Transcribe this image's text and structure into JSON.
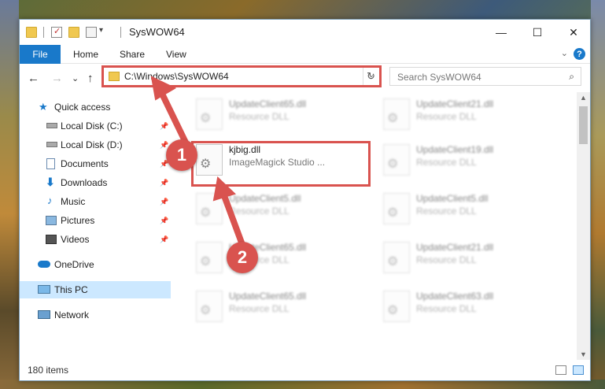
{
  "window": {
    "title": "SysWOW64",
    "minimize": "—",
    "maximize": "☐",
    "close": "✕"
  },
  "ribbon": {
    "file": "File",
    "home": "Home",
    "share": "Share",
    "view": "View",
    "help": "?"
  },
  "address": {
    "path": "C:\\Windows\\SysWOW64",
    "refresh": "↻"
  },
  "search": {
    "placeholder": "Search SysWOW64",
    "icon": "⌕"
  },
  "nav": {
    "back": "←",
    "forward": "→",
    "recent": "⌄",
    "up": "↑"
  },
  "sidebar": {
    "items": [
      {
        "label": "Quick access",
        "icon": "star-icon"
      },
      {
        "label": "Local Disk (C:)",
        "icon": "drive-icon",
        "pinned": true
      },
      {
        "label": "Local Disk (D:)",
        "icon": "drive-icon",
        "pinned": true
      },
      {
        "label": "Documents",
        "icon": "documents-icon",
        "pinned": true
      },
      {
        "label": "Downloads",
        "icon": "download-icon",
        "pinned": true
      },
      {
        "label": "Music",
        "icon": "music-icon",
        "pinned": true
      },
      {
        "label": "Pictures",
        "icon": "pictures-icon",
        "pinned": true
      },
      {
        "label": "Videos",
        "icon": "videos-icon",
        "pinned": true
      },
      {
        "label": "OneDrive",
        "icon": "cloud-icon"
      },
      {
        "label": "This PC",
        "icon": "computer-icon",
        "selected": true
      },
      {
        "label": "Network",
        "icon": "network-icon"
      }
    ]
  },
  "files": [
    {
      "name": "UpdateClient65.dll",
      "type": "Resource DLL"
    },
    {
      "name": "UpdateClient21.dll",
      "type": "Resource DLL"
    },
    {
      "name": "kjbig.dll",
      "type": "ImageMagick Studio ..."
    },
    {
      "name": "UpdateClient19.dll",
      "type": "Resource DLL"
    },
    {
      "name": "UpdateClient5.dll",
      "type": "Resource DLL"
    },
    {
      "name": "UpdateClient5.dll",
      "type": "Resource DLL"
    },
    {
      "name": "UpdateClient65.dll",
      "type": "Resource DLL"
    },
    {
      "name": "UpdateClient21.dll",
      "type": "Resource DLL"
    },
    {
      "name": "UpdateClient65.dll",
      "type": "Resource DLL"
    },
    {
      "name": "UpdateClient63.dll",
      "type": "Resource DLL"
    }
  ],
  "status": {
    "count": "180 items"
  },
  "markers": {
    "one": "1",
    "two": "2"
  },
  "colors": {
    "accent": "#1979ca",
    "highlight": "#d9534f",
    "selected": "#cce8ff"
  }
}
